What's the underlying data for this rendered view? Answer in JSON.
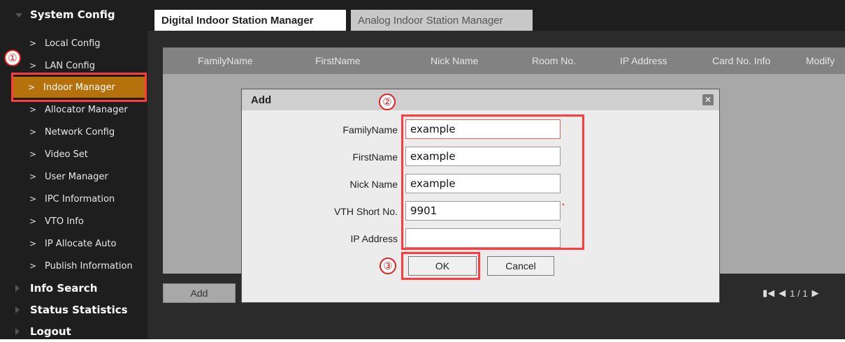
{
  "sidebar": {
    "sections": [
      {
        "label": "System Config",
        "expanded": true
      },
      {
        "label": "Info Search",
        "expanded": false
      },
      {
        "label": "Status Statistics",
        "expanded": false
      },
      {
        "label": "Logout",
        "expanded": false
      }
    ],
    "items": [
      {
        "label": "Local Config"
      },
      {
        "label": "LAN Config"
      },
      {
        "label": "Indoor Manager",
        "active": true
      },
      {
        "label": "Allocator Manager"
      },
      {
        "label": "Network Config"
      },
      {
        "label": "Video Set"
      },
      {
        "label": "User Manager"
      },
      {
        "label": "IPC Information"
      },
      {
        "label": "VTO Info"
      },
      {
        "label": "IP Allocate Auto"
      },
      {
        "label": "Publish Information"
      }
    ],
    "chevron": ">"
  },
  "tabs": [
    {
      "label": "Digital Indoor Station Manager",
      "active": true
    },
    {
      "label": "Analog Indoor Station Manager",
      "active": false
    }
  ],
  "table": {
    "columns": [
      "FamilyName",
      "FirstName",
      "Nick Name",
      "Room No.",
      "IP Address",
      "Card No. Info",
      "Modify"
    ]
  },
  "add_button": "Add",
  "pager": {
    "text": "1 / 1"
  },
  "dialog": {
    "title": "Add",
    "close_icon": "close-icon",
    "fields": [
      {
        "label": "FamilyName",
        "value": "example"
      },
      {
        "label": "FirstName",
        "value": "example"
      },
      {
        "label": "Nick Name",
        "value": "example"
      },
      {
        "label": "VTH Short No.",
        "value": "9901",
        "required_mark": "*"
      },
      {
        "label": "IP Address",
        "value": ""
      }
    ],
    "ok_label": "OK",
    "cancel_label": "Cancel"
  },
  "annotations": [
    "①",
    "②",
    "③"
  ],
  "colors": {
    "sidebar_bg": "#1e1e1e",
    "active_item": "#b5720c",
    "annotation_red": "#ff3b3b"
  }
}
